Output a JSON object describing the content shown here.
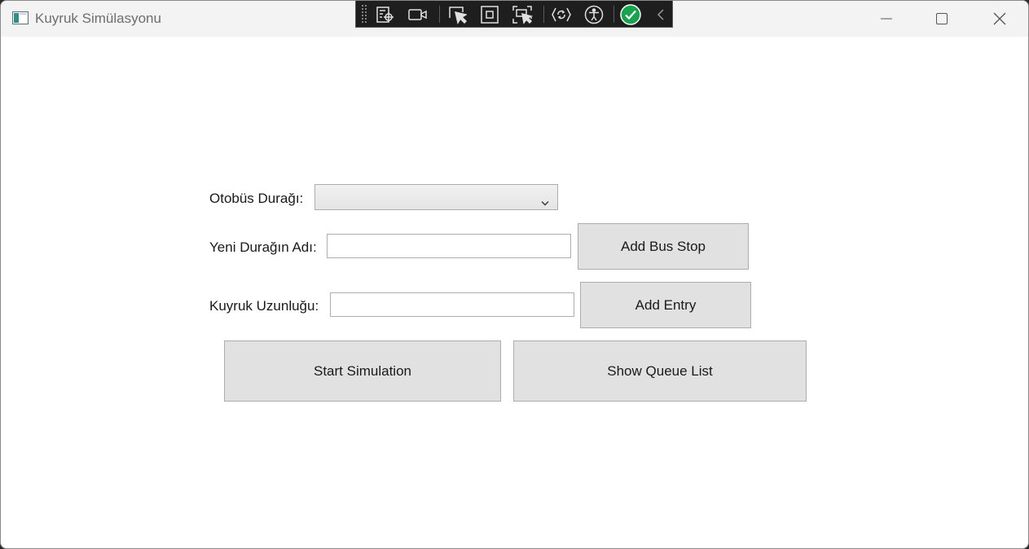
{
  "window": {
    "title": "Kuyruk Simülasyonu",
    "controls": {
      "minimize": "minimize-icon",
      "maximize": "maximize-icon",
      "close": "close-icon"
    }
  },
  "dev_toolbar": {
    "tools": [
      "live-visual-tree-icon",
      "video-camera-icon",
      "select-element-icon",
      "display-layout-adorners-icon",
      "track-focus-icon",
      "hot-reload-icon",
      "accessibility-icon",
      "binding-failures-ok-icon",
      "collapse-toolbar-icon"
    ]
  },
  "form": {
    "bus_stop_label": "Otobüs Durağı:",
    "bus_stop_selected": "",
    "new_stop_label": "Yeni Durağın Adı:",
    "new_stop_value": "",
    "add_bus_stop_button": "Add Bus Stop",
    "queue_length_label": "Kuyruk Uzunluğu:",
    "queue_length_value": "",
    "add_entry_button": "Add Entry",
    "start_simulation_button": "Start Simulation",
    "show_queue_list_button": "Show Queue List"
  },
  "colors": {
    "titlebar": "#f3f3f3",
    "window_background": "#ffffff",
    "button_face": "#e1e1e1",
    "button_border": "#adadad",
    "toolbar_background": "#1e1e1e",
    "status_ok": "#1aa251"
  }
}
